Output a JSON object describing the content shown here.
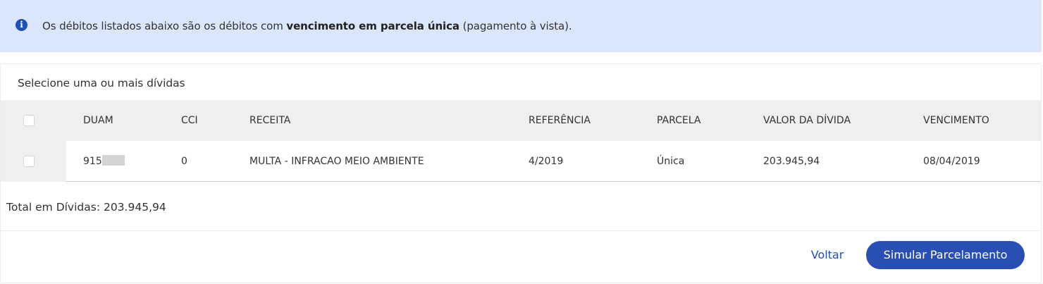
{
  "alert": {
    "icon": "info-icon",
    "text_before": "Os débitos listados abaixo são os débitos com ",
    "text_bold": "vencimento em parcela única",
    "text_after": " (pagamento à vista)."
  },
  "card": {
    "title": "Selecione uma ou mais dívidas"
  },
  "table": {
    "columns": [
      "DUAM",
      "CCI",
      "RECEITA",
      "REFERÊNCIA",
      "PARCELA",
      "VALOR DA DÍVIDA",
      "VENCIMENTO"
    ],
    "rows": [
      {
        "checked": false,
        "duam": "915",
        "cci": "0",
        "receita": "MULTA - INFRACAO MEIO AMBIENTE",
        "referencia": "4/2019",
        "parcela": "Única",
        "valor": "203.945,94",
        "vencimento": "08/04/2019"
      }
    ]
  },
  "total": {
    "label": "Total em Dívidas: 203.945,94"
  },
  "actions": {
    "back_label": "Voltar",
    "simulate_label": "Simular Parcelamento"
  },
  "colors": {
    "alert_bg": "#d9e6fb",
    "primary": "#2a4fb4",
    "header_bg": "#efefef"
  }
}
